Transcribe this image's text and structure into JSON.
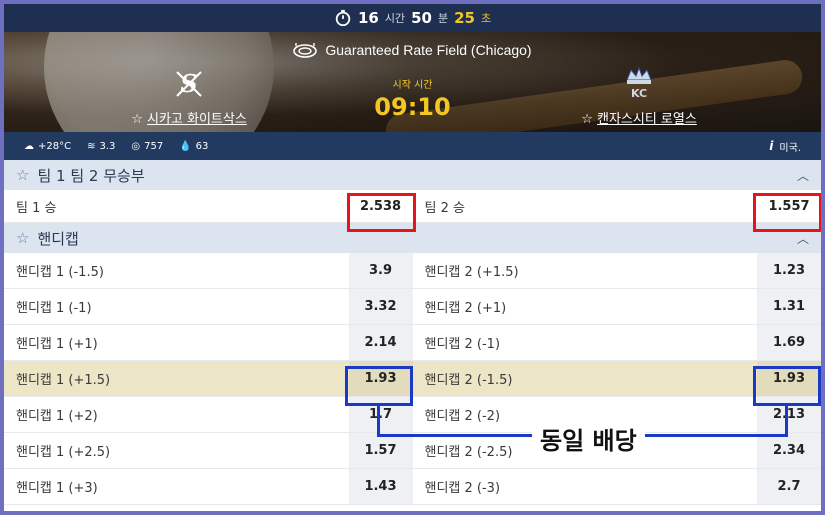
{
  "timer": {
    "hours": "16",
    "hours_unit": "시간",
    "minutes": "50",
    "minutes_unit": "분",
    "seconds": "25",
    "seconds_unit": "초"
  },
  "match": {
    "venue": "Guaranteed Rate Field (Chicago)",
    "start_label": "시작 시간",
    "start_time": "09:10",
    "home_team": "시카고 화이트삭스",
    "away_team": "캔자스시티 로열스"
  },
  "weather": {
    "temperature": "+28°C",
    "wind": "3.3",
    "pressure": "757",
    "humidity": "63",
    "region": "미국."
  },
  "markets": {
    "winner": {
      "title": "팀 1 팀 2 무승부",
      "team1_label": "팀 1 승",
      "team1_odd": "2.538",
      "team2_label": "팀 2 승",
      "team2_odd": "1.557"
    },
    "handicap": {
      "title": "핸디캡",
      "rows": [
        {
          "l1": "핸디캡 1 (-1.5)",
          "o1": "3.9",
          "l2": "핸디캡 2 (+1.5)",
          "o2": "1.23"
        },
        {
          "l1": "핸디캡 1 (-1)",
          "o1": "3.32",
          "l2": "핸디캡 2 (+1)",
          "o2": "1.31"
        },
        {
          "l1": "핸디캡 1 (+1)",
          "o1": "2.14",
          "l2": "핸디캡 2 (-1)",
          "o2": "1.69"
        },
        {
          "l1": "핸디캡 1 (+1.5)",
          "o1": "1.93",
          "l2": "핸디캡 2 (-1.5)",
          "o2": "1.93"
        },
        {
          "l1": "핸디캡 1 (+2)",
          "o1": "1.7",
          "l2": "핸디캡 2 (-2)",
          "o2": "2.13"
        },
        {
          "l1": "핸디캡 1 (+2.5)",
          "o1": "1.57",
          "l2": "핸디캡 2 (-2.5)",
          "o2": "2.34"
        },
        {
          "l1": "핸디캡 1 (+3)",
          "o1": "1.43",
          "l2": "핸디캡 2 (-3)",
          "o2": "2.7"
        }
      ]
    }
  },
  "annotation": {
    "callout": "동일 배당",
    "red_color": "#e8141b",
    "blue_color": "#1b39c9"
  }
}
